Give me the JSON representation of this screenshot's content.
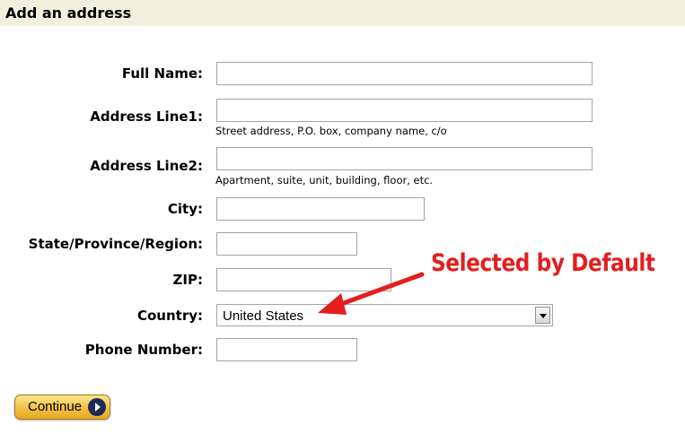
{
  "header": {
    "title": "Add an address"
  },
  "form": {
    "full_name": {
      "label": "Full Name:",
      "value": ""
    },
    "address_line1": {
      "label": "Address Line1:",
      "value": "",
      "hint": "Street address, P.O. box, company name, c/o"
    },
    "address_line2": {
      "label": "Address Line2:",
      "value": "",
      "hint": "Apartment, suite, unit, building, floor, etc."
    },
    "city": {
      "label": "City:",
      "value": ""
    },
    "state": {
      "label": "State/Province/Region:",
      "value": ""
    },
    "zip": {
      "label": "ZIP:",
      "value": ""
    },
    "country": {
      "label": "Country:",
      "selected": "United States"
    },
    "phone": {
      "label": "Phone Number:",
      "value": ""
    }
  },
  "annotation": {
    "text": "Selected by Default",
    "color": "#e31e1e"
  },
  "actions": {
    "continue_label": "Continue"
  }
}
